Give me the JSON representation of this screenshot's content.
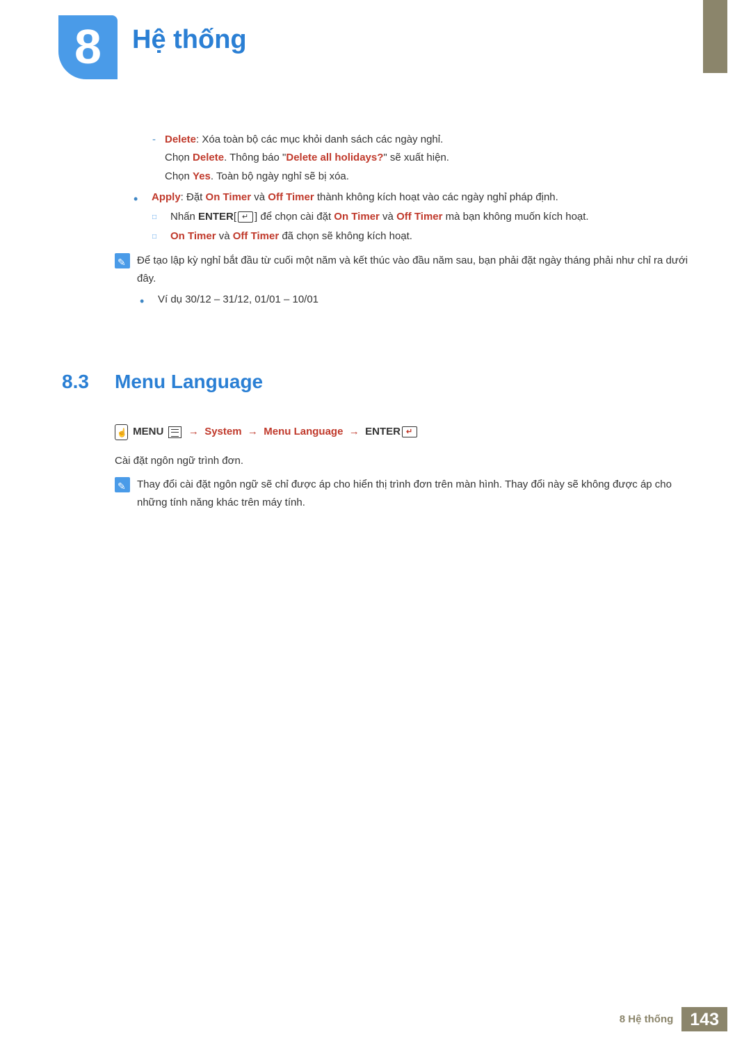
{
  "chapter": {
    "number": "8",
    "title": "Hệ thống"
  },
  "body": {
    "delete": {
      "label": "Delete",
      "desc": ": Xóa toàn bộ các mục khỏi danh sách các ngày nghỉ.",
      "line2_a": "Chọn ",
      "line2_b": "Delete",
      "line2_c": ". Thông báo \"",
      "line2_d": "Delete all holidays?",
      "line2_e": "\" sẽ xuất hiện.",
      "line3_a": "Chọn ",
      "line3_b": "Yes",
      "line3_c": ". Toàn bộ ngày nghỉ sẽ bị xóa."
    },
    "apply": {
      "label": "Apply",
      "desc1": ": Đặt ",
      "on_timer": "On Timer",
      "and": " và ",
      "off_timer": "Off Timer",
      "desc2": " thành không kích hoạt vào các ngày nghỉ pháp định."
    },
    "enter_line": {
      "a": "Nhấn ",
      "b": "ENTER",
      "c": " để chọn cài đặt ",
      "on": "On Timer",
      "and": " và ",
      "off": "Off Timer",
      "d": " mà bạn không muốn kích hoạt."
    },
    "chosen_line": {
      "on": "On Timer",
      "and": " và ",
      "off": "Off Timer",
      "d": " đã chọn sẽ không kích hoạt."
    },
    "note1": {
      "text": "Để tạo lập kỳ nghỉ bắt đầu từ cuối một năm và kết thúc vào đầu năm sau, bạn phải đặt ngày tháng phải như chỉ ra dưới đây.",
      "example": "Ví dụ 30/12 – 31/12, 01/01 – 10/01"
    }
  },
  "section": {
    "num": "8.3",
    "title": "Menu Language",
    "nav": {
      "menu": "MENU",
      "arrow": "→",
      "system": "System",
      "menu_language": "Menu Language",
      "enter": "ENTER"
    },
    "para": "Cài đặt ngôn ngữ trình đơn.",
    "note": "Thay đổi cài đặt ngôn ngữ sẽ chỉ được áp cho hiển thị trình đơn trên màn hình. Thay đổi này sẽ không được áp cho những tính năng khác trên máy tính."
  },
  "footer": {
    "label": "8 Hệ thống",
    "page": "143"
  }
}
